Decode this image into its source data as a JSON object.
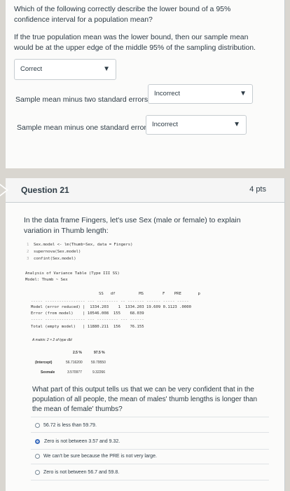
{
  "q20": {
    "prompt": "Which of the following correctly describe the lower bound of a 95% confidence interval for a population mean?",
    "statement1": "If the true population mean was the lower bound, then our sample mean would be at the upper edge of the middle 95% of the sampling distribution.",
    "select1_value": "Correct",
    "statement2": "Sample mean minus two standard errors.",
    "select2_value": "Incorrect",
    "statement3": "Sample mean minus one standard error.",
    "select3_value": "Incorrect"
  },
  "q21": {
    "title": "Question 21",
    "points": "4 pts",
    "intro": "In the data frame Fingers, let's use Sex (male or female) to explain variation in Thumb length:",
    "code_lines": [
      {
        "n": "1",
        "text": "Sex.model <- lm(Thumb~Sex, data = Fingers)"
      },
      {
        "n": "2",
        "text": "supernova(Sex.model)"
      },
      {
        "n": "3",
        "text": "confint(Sex.model)"
      }
    ],
    "anova_title": "Analysis of Variance Table (Type III SS)",
    "anova_model": "Model: Thumb ~ Sex",
    "anova_header": "                              SS   df          MS        F    PRE       p",
    "anova_sep1": "----- ----------------- --- --------- -- ------- ------ ----- -----",
    "anova_row1": "Model (error reduced) |  1334.203    1  1334.203 19.609 0.1123 .0000",
    "anova_row2": "Error (from model)    | 10546.008  155    68.039",
    "anova_sep2": "----- ----------------- --- --------- --- ------",
    "anova_row3": "Total (empty model)   | 11880.211  156    76.155",
    "matrix_label": "A matrix: 2 × 2 of type dbl",
    "ci_header_1": "2.5 %",
    "ci_header_2": "97.5 %",
    "ci_row1_label": "(Intercept)",
    "ci_row1_v1": "56.716200",
    "ci_row1_v2": "59.79550",
    "ci_row2_label": "Sexmale",
    "ci_row2_v1": "3.570977",
    "ci_row2_v2": "9.32266",
    "question": "What part of this output tells us that we can be very confident that in the population of all people, the mean of males' thumb lengths is longer than the mean of female' thumbs?",
    "options": [
      {
        "label": "56.72 is less than 59.79.",
        "selected": false
      },
      {
        "label": "Zero is not between 3.57 and 9.32.",
        "selected": true
      },
      {
        "label": "We can't be sure because the PRE is not very large.",
        "selected": false
      },
      {
        "label": "Zero is not between 56.7 and 59.8.",
        "selected": false
      }
    ]
  },
  "icons": {
    "chevron": "chevron-down-icon",
    "question_marker": "question-arrow-icon"
  },
  "colors": {
    "accent": "#3b6dbd",
    "text": "#2d3b45",
    "border": "#c7cdd1"
  }
}
